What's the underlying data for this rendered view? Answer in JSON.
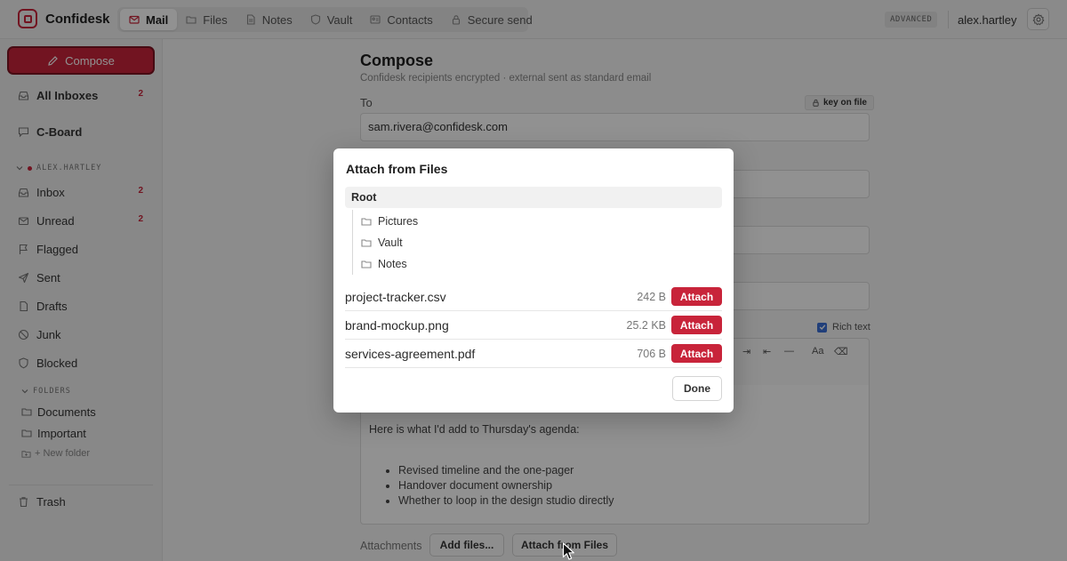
{
  "app": {
    "name": "Confidesk",
    "accent": "#c8243a"
  },
  "nav": {
    "tabs": [
      {
        "label": "Mail",
        "icon": "mail-icon",
        "active": true
      },
      {
        "label": "Files",
        "icon": "folder-icon"
      },
      {
        "label": "Notes",
        "icon": "note-icon"
      },
      {
        "label": "Vault",
        "icon": "shield-icon"
      },
      {
        "label": "Contacts",
        "icon": "contacts-icon"
      },
      {
        "label": "Secure send",
        "icon": "lock-icon"
      }
    ],
    "mode_badge": "ADVANCED",
    "username": "alex.hartley"
  },
  "sidebar": {
    "compose_label": "Compose",
    "all_inboxes": {
      "label": "All Inboxes",
      "count": "2"
    },
    "cboard": {
      "label": "C-Board"
    },
    "account_label": "ALEX.HARTLEY",
    "items": [
      {
        "label": "Inbox",
        "count": "2"
      },
      {
        "label": "Unread",
        "count": "2"
      },
      {
        "label": "Flagged"
      },
      {
        "label": "Sent"
      },
      {
        "label": "Drafts"
      },
      {
        "label": "Junk"
      },
      {
        "label": "Blocked"
      }
    ],
    "folders_label": "FOLDERS",
    "folders": [
      {
        "label": "Documents"
      },
      {
        "label": "Important"
      }
    ],
    "new_folder_label": "+ New folder",
    "trash_label": "Trash"
  },
  "compose": {
    "title": "Compose",
    "subtitle": "Confidesk recipients encrypted · external sent as standard email",
    "to_label": "To",
    "key_badge": "key on file",
    "to_value": "sam.rivera@confidesk.com",
    "rich_text_label": "Rich text",
    "rich_text_checked": true,
    "body_line": "Here is what I'd add to Thursday's agenda:",
    "body_bullets": [
      "Revised timeline and the one-pager",
      "Handover document ownership",
      "Whether to loop in the design studio directly"
    ],
    "attachments_label": "Attachments",
    "add_files_label": "Add files...",
    "attach_from_files_label": "Attach from Files"
  },
  "modal": {
    "title": "Attach from Files",
    "root_label": "Root",
    "folders": [
      {
        "label": "Pictures"
      },
      {
        "label": "Vault"
      },
      {
        "label": "Notes"
      }
    ],
    "files": [
      {
        "name": "project-tracker.csv",
        "size": "242 B",
        "action": "Attach"
      },
      {
        "name": "brand-mockup.png",
        "size": "25.2 KB",
        "action": "Attach"
      },
      {
        "name": "services-agreement.pdf",
        "size": "706 B",
        "action": "Attach"
      }
    ],
    "done_label": "Done"
  }
}
